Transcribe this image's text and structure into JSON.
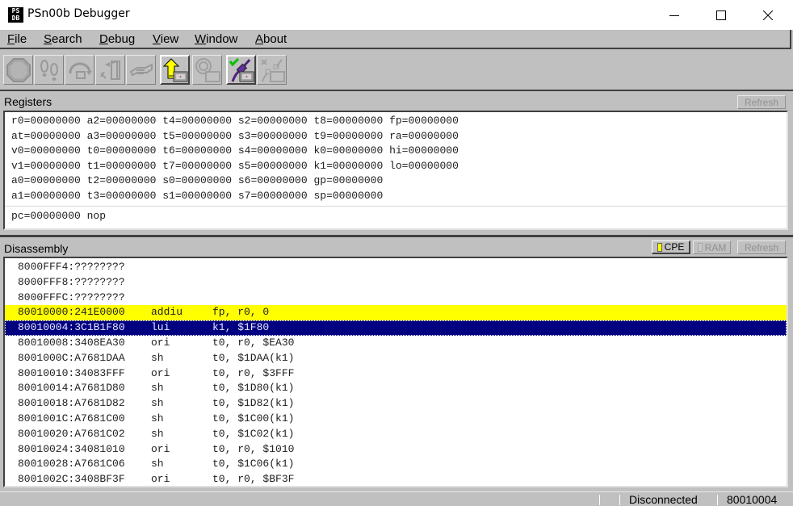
{
  "window": {
    "title": "PSn00b Debugger",
    "app_icon": "PS\nDB"
  },
  "menubar": {
    "items": [
      {
        "label": "File",
        "accel": "F"
      },
      {
        "label": "Search",
        "accel": "S"
      },
      {
        "label": "Debug",
        "accel": "D"
      },
      {
        "label": "View",
        "accel": "V"
      },
      {
        "label": "Window",
        "accel": "W"
      },
      {
        "label": "About",
        "accel": "A"
      }
    ]
  },
  "toolbar": {
    "buttons": [
      {
        "icon": "stop-icon",
        "enabled": false
      },
      {
        "icon": "step-footprints-icon",
        "enabled": false
      },
      {
        "icon": "step-over-icon",
        "enabled": false
      },
      {
        "icon": "step-out-icon",
        "enabled": false
      },
      {
        "icon": "run-to-handshake-icon",
        "enabled": false
      },
      {
        "icon": "upload-arrow-icon",
        "enabled": true
      },
      {
        "icon": "reboot-icon",
        "enabled": false
      },
      {
        "icon": "connect-icon",
        "enabled": true
      },
      {
        "icon": "disconnect-icon",
        "enabled": false
      }
    ]
  },
  "registers": {
    "label": "Registers",
    "refresh_label": "Refresh",
    "rows": [
      "r0=00000000 a2=00000000 t4=00000000 s2=00000000 t8=00000000 fp=00000000",
      "at=00000000 a3=00000000 t5=00000000 s3=00000000 t9=00000000 ra=00000000",
      "v0=00000000 t0=00000000 t6=00000000 s4=00000000 k0=00000000 hi=00000000",
      "v1=00000000 t1=00000000 t7=00000000 s5=00000000 k1=00000000 lo=00000000",
      "a0=00000000 t2=00000000 s0=00000000 s6=00000000 gp=00000000",
      "a1=00000000 t3=00000000 s1=00000000 s7=00000000 sp=00000000"
    ],
    "pc_line": "pc=00000000 nop"
  },
  "disassembly": {
    "label": "Disassembly",
    "cpe_label": "CPE",
    "ram_label": "RAM",
    "refresh_label": "Refresh",
    "colors": {
      "pc_highlight": "#ffff00",
      "selection": "#000080"
    },
    "rows": [
      {
        "addr": "8000FFF4:????????",
        "mnem": "",
        "ops": "",
        "state": ""
      },
      {
        "addr": "8000FFF8:????????",
        "mnem": "",
        "ops": "",
        "state": ""
      },
      {
        "addr": "8000FFFC:????????",
        "mnem": "",
        "ops": "",
        "state": ""
      },
      {
        "addr": "80010000:241E0000",
        "mnem": "addiu",
        "ops": "fp, r0, 0",
        "state": "pc"
      },
      {
        "addr": "80010004:3C1B1F80",
        "mnem": "lui",
        "ops": "k1, $1F80",
        "state": "sel"
      },
      {
        "addr": "80010008:3408EA30",
        "mnem": "ori",
        "ops": "t0, r0, $EA30",
        "state": ""
      },
      {
        "addr": "8001000C:A7681DAA",
        "mnem": "sh",
        "ops": "t0, $1DAA(k1)",
        "state": ""
      },
      {
        "addr": "80010010:34083FFF",
        "mnem": "ori",
        "ops": "t0, r0, $3FFF",
        "state": ""
      },
      {
        "addr": "80010014:A7681D80",
        "mnem": "sh",
        "ops": "t0, $1D80(k1)",
        "state": ""
      },
      {
        "addr": "80010018:A7681D82",
        "mnem": "sh",
        "ops": "t0, $1D82(k1)",
        "state": ""
      },
      {
        "addr": "8001001C:A7681C00",
        "mnem": "sh",
        "ops": "t0, $1C00(k1)",
        "state": ""
      },
      {
        "addr": "80010020:A7681C02",
        "mnem": "sh",
        "ops": "t0, $1C02(k1)",
        "state": ""
      },
      {
        "addr": "80010024:34081010",
        "mnem": "ori",
        "ops": "t0, r0, $1010",
        "state": ""
      },
      {
        "addr": "80010028:A7681C06",
        "mnem": "sh",
        "ops": "t0, $1C06(k1)",
        "state": ""
      },
      {
        "addr": "8001002C:3408BF3F",
        "mnem": "ori",
        "ops": "t0, r0, $BF3F",
        "state": ""
      }
    ]
  },
  "statusbar": {
    "connection": "Disconnected",
    "address": "80010004"
  }
}
